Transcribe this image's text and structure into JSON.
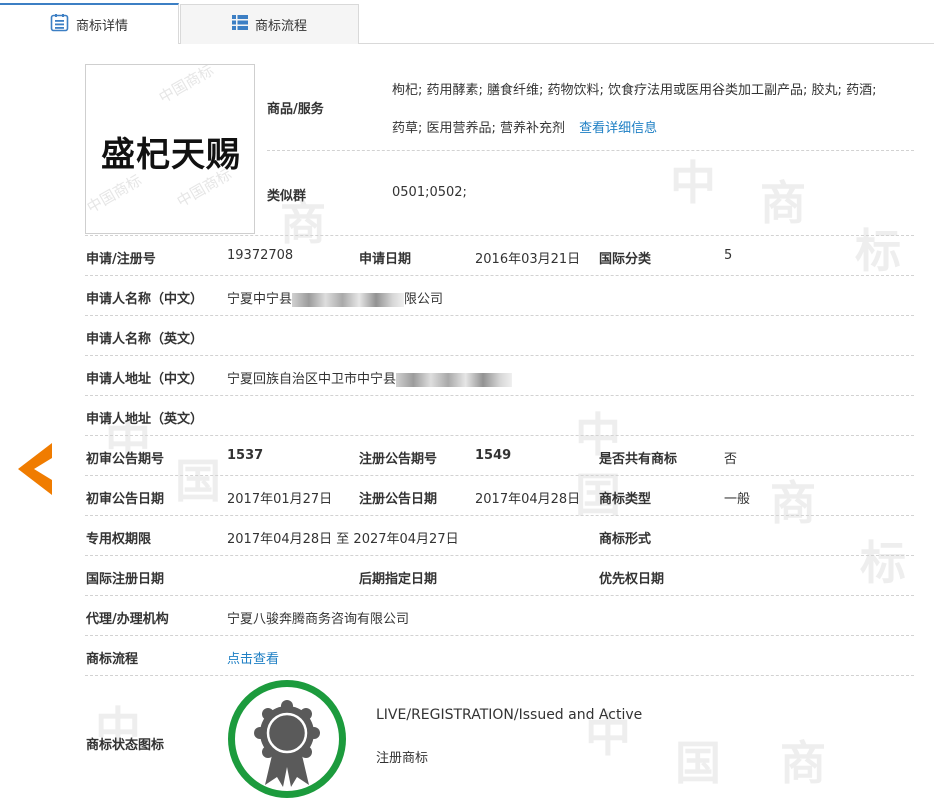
{
  "tabs": [
    {
      "label": "商标详情",
      "icon": "document-list-icon",
      "active": true
    },
    {
      "label": "商标流程",
      "icon": "grid-list-icon",
      "active": false
    }
  ],
  "watermark": {
    "chars": [
      "中",
      "国",
      "商",
      "标"
    ],
    "color": "#eeeeee"
  },
  "logo": {
    "text": "盛杞天赐",
    "watermark_text": "中国商标"
  },
  "goods_services": {
    "label": "商品/服务",
    "line1": "枸杞; 药用酵素; 膳食纤维; 药物饮料; 饮食疗法用或医用谷类加工副产品; 胶丸; 药酒;",
    "line2": "药草; 医用营养品; 营养补充剂",
    "detail_link": "查看详细信息"
  },
  "similar_group": {
    "label": "类似群",
    "value": "0501;0502;"
  },
  "fields": {
    "reg_no_label": "申请/注册号",
    "reg_no": "19372708",
    "apply_date_label": "申请日期",
    "apply_date": "2016年03月21日",
    "intl_class_label": "国际分类",
    "intl_class": "5",
    "applicant_cn_label": "申请人名称（中文）",
    "applicant_cn_prefix": "宁夏中宁县",
    "applicant_cn_suffix": "限公司",
    "applicant_en_label": "申请人名称（英文）",
    "address_cn_label": "申请人地址（中文）",
    "address_cn_prefix": "宁夏回族自治区中卫市中宁县",
    "address_en_label": "申请人地址（英文）",
    "prelim_no_label": "初审公告期号",
    "prelim_no": "1537",
    "reg_pub_no_label": "注册公告期号",
    "reg_pub_no": "1549",
    "shared_label": "是否共有商标",
    "shared": "否",
    "prelim_date_label": "初审公告日期",
    "prelim_date": "2017年01月27日",
    "reg_pub_date_label": "注册公告日期",
    "reg_pub_date": "2017年04月28日",
    "tm_type_label": "商标类型",
    "tm_type": "一般",
    "exclusive_label": "专用权期限",
    "exclusive_period": "2017年04月28日 至 2027年04月27日",
    "tm_form_label": "商标形式",
    "intl_reg_date_label": "国际注册日期",
    "later_date_label": "后期指定日期",
    "priority_date_label": "优先权日期",
    "agent_label": "代理/办理机构",
    "agent": "宁夏八骏奔腾商务咨询有限公司",
    "flow_label": "商标流程",
    "flow_link": "点击查看",
    "status_icon_label": "商标状态图标",
    "status_en": "LIVE/REGISTRATION/Issued and Active",
    "status_cn": "注册商标"
  },
  "colors": {
    "accent": "#3c7fc4",
    "link": "#1e7fc4",
    "arrow": "#f07c00",
    "seal": "#1c9b3d",
    "badge": "#5a5a5a"
  }
}
